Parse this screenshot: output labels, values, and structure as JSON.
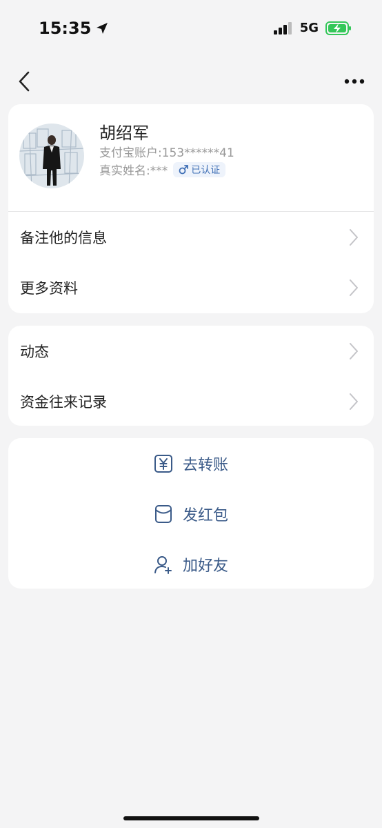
{
  "status_bar": {
    "time": "15:35",
    "network": "5G"
  },
  "profile": {
    "name": "胡绍军",
    "account": "支付宝账户:153******41",
    "real_name": "真实姓名:***",
    "verified_label": "已认证",
    "gender_icon": "male-icon"
  },
  "info_rows": [
    {
      "label": "备注他的信息"
    },
    {
      "label": "更多资料"
    }
  ],
  "activity_rows": [
    {
      "label": "动态"
    },
    {
      "label": "资金往来记录"
    }
  ],
  "actions": [
    {
      "label": "去转账",
      "icon": "yuan-transfer-icon"
    },
    {
      "label": "发红包",
      "icon": "red-envelope-icon"
    },
    {
      "label": "加好友",
      "icon": "add-friend-icon"
    }
  ],
  "colors": {
    "background": "#f4f4f5",
    "action_text": "#3a5a88",
    "badge_text": "#3f6fb5",
    "battery": "#34c759"
  }
}
